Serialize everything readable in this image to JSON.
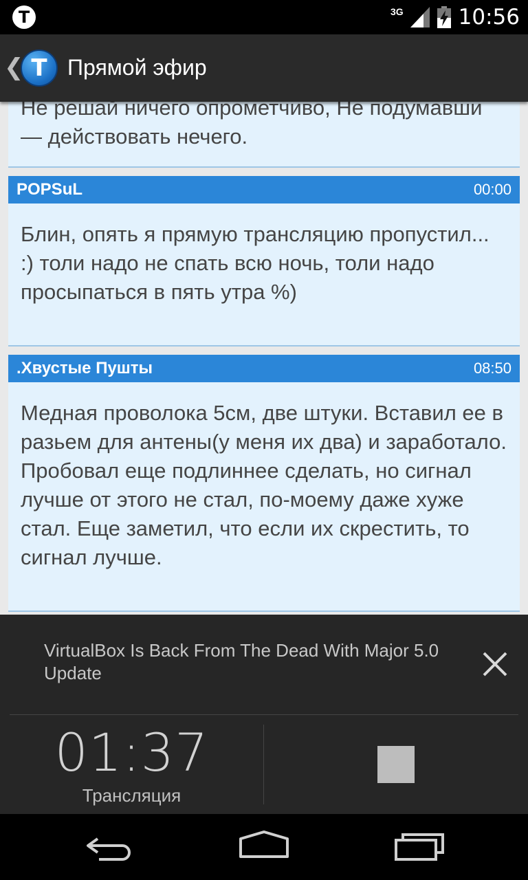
{
  "status_bar": {
    "app_icon_letter": "T",
    "network_type": "3G",
    "time": "10:56"
  },
  "action_bar": {
    "back_glyph": "❮",
    "logo_letter": "T",
    "title": "Прямой эфир"
  },
  "feed": {
    "top_partial_text": " Не решай ничего опрометчиво, Не подумавши — действовать нечего.",
    "messages": [
      {
        "author": "POPSuL",
        "time": "00:00",
        "text": "Блин, опять я прямую трансляцию пропустил... :) толи надо не спать всю ночь, толи надо просыпаться в пять утра %)"
      },
      {
        "author": ".Хвустые Пушты",
        "time": "08:50",
        "text": "Медная проволока 5см, две штуки. Вставил ее в разьем для антены(у меня их два) и заработало. Пробовал еще подлиннее сделать, но сигнал лучше от этого не стал, по-моему даже хуже стал. Еще заметил, что если их скрестить, то сигнал лучше."
      }
    ]
  },
  "player": {
    "headline": "VirtualBox Is Back From The Dead With Major 5.0 Update",
    "timer": "01:37",
    "timer_label": "Трансляция"
  },
  "icons": {
    "signal": "signal-icon",
    "battery": "battery-charging-icon",
    "close": "close-icon",
    "stop": "stop-icon",
    "back": "nav-back-icon",
    "home": "nav-home-icon",
    "recents": "nav-recents-icon"
  },
  "colors": {
    "header_blue": "#2b86d8",
    "card_bg": "#e3f2fd",
    "panel_bg": "#262626"
  }
}
